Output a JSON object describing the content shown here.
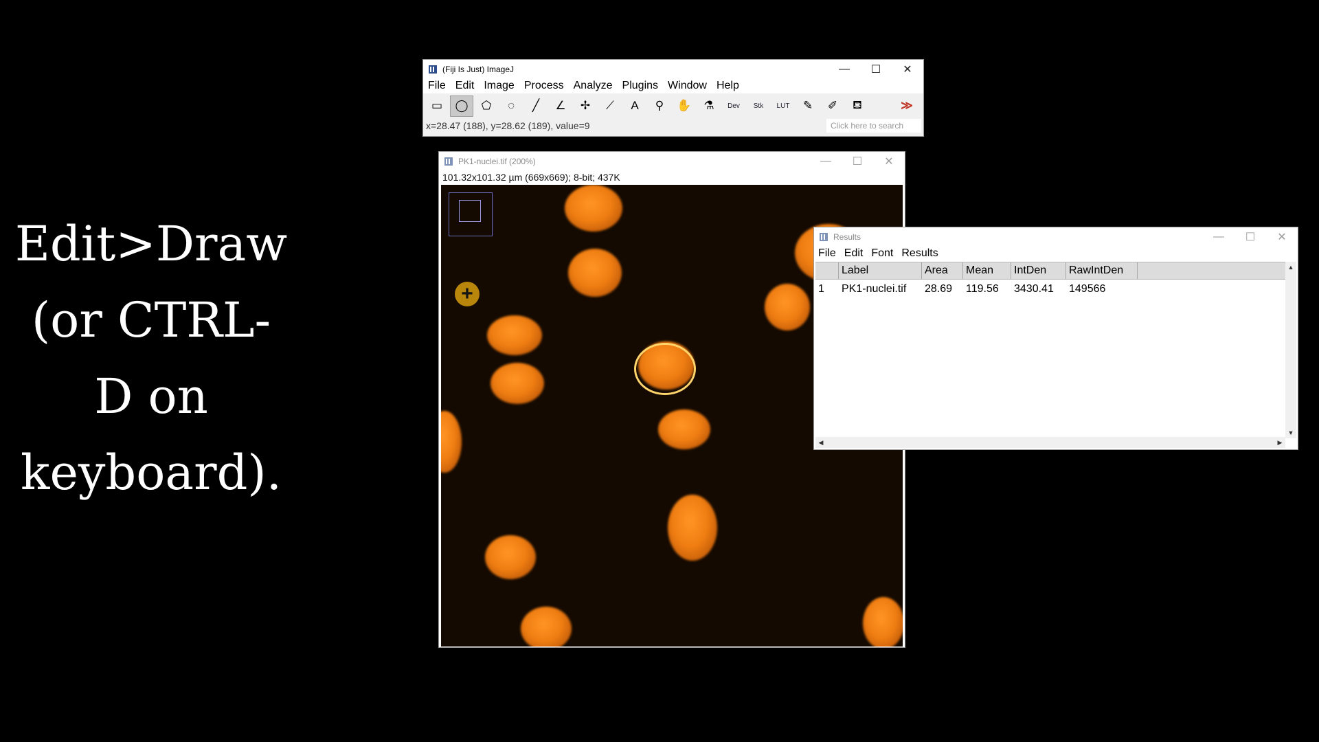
{
  "caption": {
    "lines": [
      "Edit>Draw",
      "(or CTRL-",
      "D on",
      "keyboard)."
    ]
  },
  "main_window": {
    "title": "(Fiji Is Just) ImageJ",
    "menu": [
      "File",
      "Edit",
      "Image",
      "Process",
      "Analyze",
      "Plugins",
      "Window",
      "Help"
    ],
    "tools": [
      {
        "name": "rectangle-tool-icon",
        "glyph": "▭"
      },
      {
        "name": "oval-tool-icon",
        "glyph": "◯"
      },
      {
        "name": "polygon-tool-icon",
        "glyph": "⬠"
      },
      {
        "name": "freehand-tool-icon",
        "glyph": "◌"
      },
      {
        "name": "line-tool-icon",
        "glyph": "╱"
      },
      {
        "name": "angle-tool-icon",
        "glyph": "∠"
      },
      {
        "name": "point-tool-icon",
        "glyph": "✢"
      },
      {
        "name": "wand-tool-icon",
        "glyph": "⟋"
      },
      {
        "name": "text-tool-icon",
        "glyph": "A"
      },
      {
        "name": "magnifier-tool-icon",
        "glyph": "⚲"
      },
      {
        "name": "hand-tool-icon",
        "glyph": "✋"
      },
      {
        "name": "dropper-tool-icon",
        "glyph": "⚗"
      },
      {
        "name": "dev-tool-icon",
        "glyph": "Dev"
      },
      {
        "name": "stk-tool-icon",
        "glyph": "Stk"
      },
      {
        "name": "lut-tool-icon",
        "glyph": "LUT"
      },
      {
        "name": "pencil-tool-icon",
        "glyph": "✎"
      },
      {
        "name": "brush-tool-icon",
        "glyph": "✐"
      },
      {
        "name": "flood-fill-tool-icon",
        "glyph": "⛾"
      },
      {
        "name": "more-tools-icon",
        "glyph": "≫"
      }
    ],
    "status": "x=28.47 (188), y=28.62 (189), value=9",
    "search_placeholder": "Click here to search"
  },
  "image_window": {
    "title": "PK1-nuclei.tif (200%)",
    "info": "101.32x101.32 µm (669x669); 8-bit; 437K"
  },
  "results_window": {
    "title": "Results",
    "menu": [
      "File",
      "Edit",
      "Font",
      "Results"
    ],
    "columns": [
      "",
      "Label",
      "Area",
      "Mean",
      "IntDen",
      "RawIntDen"
    ],
    "rows": [
      [
        "1",
        "PK1-nuclei.tif",
        "28.69",
        "119.56",
        "3430.41",
        "149566"
      ]
    ]
  },
  "colors": {
    "nucleus": "#f07e12",
    "roi": "#ffd46a",
    "background": "#000000"
  }
}
